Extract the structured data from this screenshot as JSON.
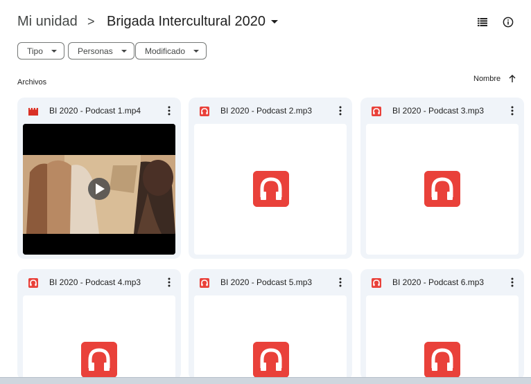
{
  "header": {
    "root_label": "Mi unidad",
    "separator": ">",
    "current_folder": "Brigada Intercultural 2020"
  },
  "filters": [
    "Tipo",
    "Personas",
    "Modificado"
  ],
  "section": {
    "title": "Archivos"
  },
  "sort": {
    "label": "Nombre"
  },
  "files": [
    {
      "name": "BI 2020 - Podcast 1.mp4",
      "type": "video"
    },
    {
      "name": "BI 2020 - Podcast 2.mp3",
      "type": "audio"
    },
    {
      "name": "BI 2020 - Podcast 3.mp3",
      "type": "audio"
    },
    {
      "name": "BI 2020 - Podcast 4.mp3",
      "type": "audio"
    },
    {
      "name": "BI 2020 - Podcast 5.mp3",
      "type": "audio"
    },
    {
      "name": "BI 2020 - Podcast 6.mp3",
      "type": "audio"
    }
  ],
  "colors": {
    "audio": "#e9413a",
    "video": "#d93025",
    "card_bg": "#f0f4f9"
  }
}
